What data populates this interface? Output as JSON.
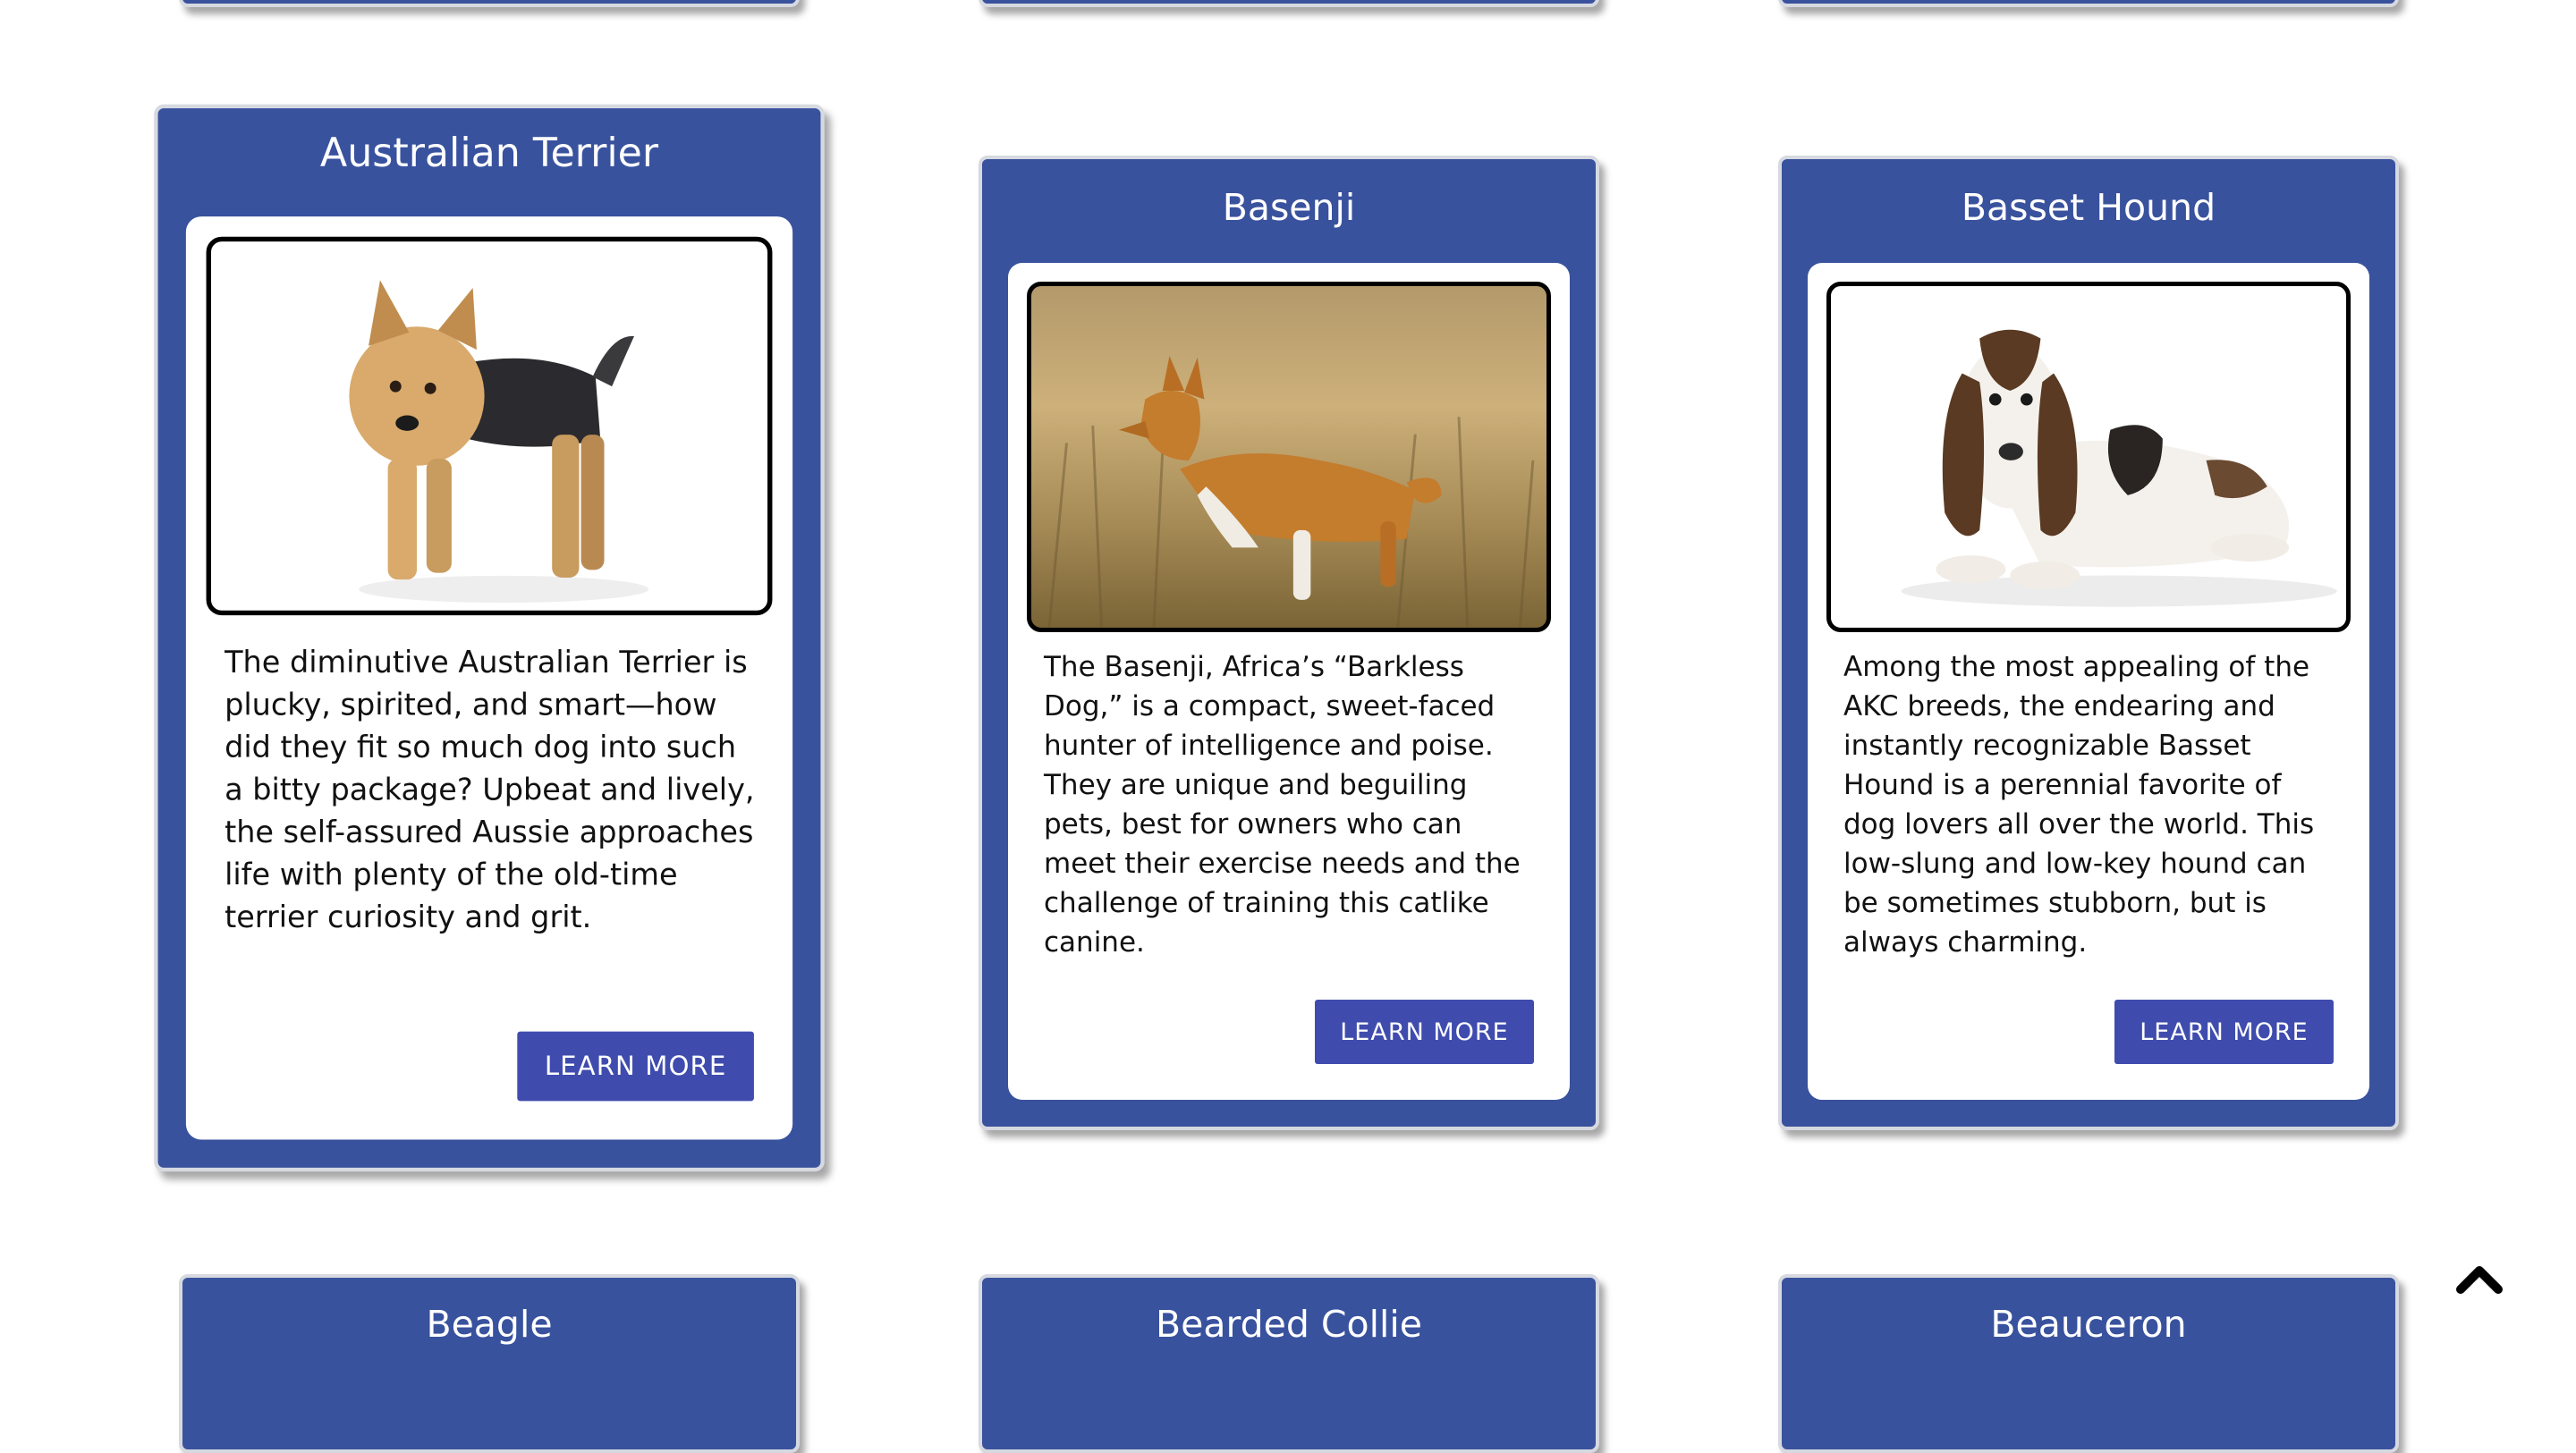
{
  "cards_partial_top": [
    {},
    {},
    {}
  ],
  "cards": [
    {
      "title": "Australian Terrier",
      "image": "australian-terrier-photo",
      "description": "The diminutive Australian Terrier is plucky, spirited, and smart—how did they fit so much dog into such a bitty package? Upbeat and lively, the self-assured Aussie approaches life with plenty of the old-time terrier curiosity and grit.",
      "button": "LEARN MORE"
    },
    {
      "title": "Basenji",
      "image": "basenji-photo",
      "description": "The Basenji, Africa’s “Barkless Dog,” is a compact, sweet-faced hunter of intelligence and poise. They are unique and beguiling pets, best for owners who can meet their exercise needs and the challenge of training this catlike canine.",
      "button": "LEARN MORE"
    },
    {
      "title": "Basset Hound",
      "image": "basset-hound-photo",
      "description": "Among the most appealing of the AKC breeds, the endearing and instantly recognizable Basset Hound is a perennial favorite of dog lovers all over the world. This low-slung and low-key hound can be sometimes stubborn, but is always charming.",
      "button": "LEARN MORE"
    }
  ],
  "cards_next_row": [
    {
      "title": "Beagle"
    },
    {
      "title": "Bearded Collie"
    },
    {
      "title": "Beauceron"
    }
  ],
  "scroll_top_icon": "chevron-up-icon",
  "colors": {
    "card": "#39529e",
    "button": "#3f4cae"
  }
}
